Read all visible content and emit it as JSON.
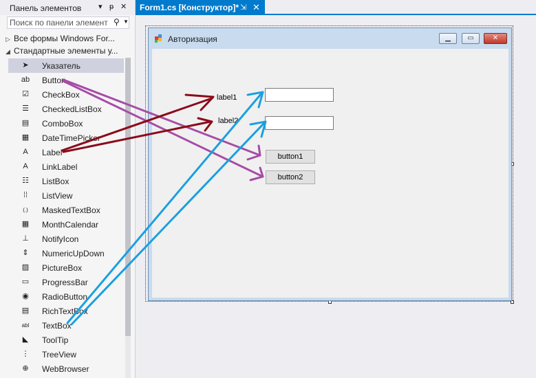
{
  "toolbox": {
    "title": "Панель элементов",
    "header_buttons": {
      "dropdown": "▾",
      "pin": "ᵽ",
      "close": "✕"
    },
    "search_placeholder": "Поиск по панели элемент",
    "group_all": "Все формы Windows For...",
    "group_standard": "Стандартные элементы у...",
    "items": [
      {
        "label": "Указатель",
        "icon": "pointer-icon",
        "glyph": "➤",
        "selected": true
      },
      {
        "label": "Button",
        "icon": "button-icon",
        "glyph": "ab"
      },
      {
        "label": "CheckBox",
        "icon": "checkbox-icon",
        "glyph": "☑"
      },
      {
        "label": "CheckedListBox",
        "icon": "checkedlistbox-icon",
        "glyph": "☰"
      },
      {
        "label": "ComboBox",
        "icon": "combobox-icon",
        "glyph": "▤"
      },
      {
        "label": "DateTimePicker",
        "icon": "datetimepicker-icon",
        "glyph": "▦"
      },
      {
        "label": "Label",
        "icon": "label-icon",
        "glyph": "A"
      },
      {
        "label": "LinkLabel",
        "icon": "linklabel-icon",
        "glyph": "A"
      },
      {
        "label": "ListBox",
        "icon": "listbox-icon",
        "glyph": "☷"
      },
      {
        "label": "ListView",
        "icon": "listview-icon",
        "glyph": "⁞⁞"
      },
      {
        "label": "MaskedTextBox",
        "icon": "maskedtextbox-icon",
        "glyph": "(.)"
      },
      {
        "label": "MonthCalendar",
        "icon": "monthcalendar-icon",
        "glyph": "▦"
      },
      {
        "label": "NotifyIcon",
        "icon": "notifyicon-icon",
        "glyph": "⊥"
      },
      {
        "label": "NumericUpDown",
        "icon": "numericupdown-icon",
        "glyph": "⇕"
      },
      {
        "label": "PictureBox",
        "icon": "picturebox-icon",
        "glyph": "▨"
      },
      {
        "label": "ProgressBar",
        "icon": "progressbar-icon",
        "glyph": "▭"
      },
      {
        "label": "RadioButton",
        "icon": "radiobutton-icon",
        "glyph": "◉"
      },
      {
        "label": "RichTextBox",
        "icon": "richtextbox-icon",
        "glyph": "▤"
      },
      {
        "label": "TextBox",
        "icon": "textbox-icon",
        "glyph": "abl"
      },
      {
        "label": "ToolTip",
        "icon": "tooltip-icon",
        "glyph": "◣"
      },
      {
        "label": "TreeView",
        "icon": "treeview-icon",
        "glyph": "⋮"
      },
      {
        "label": "WebBrowser",
        "icon": "webbrowser-icon",
        "glyph": "⊕"
      }
    ]
  },
  "tab": {
    "label": "Form1.cs [Конструктор]*",
    "pin": "⇲",
    "close": "✕"
  },
  "form": {
    "title": "Авторизация",
    "label1": "label1",
    "label2": "label2",
    "button1": "button1",
    "button2": "button2"
  },
  "annotation_colors": {
    "label": "#8b0a1a",
    "button": "#a64ca6",
    "textbox": "#1aa0e0"
  }
}
